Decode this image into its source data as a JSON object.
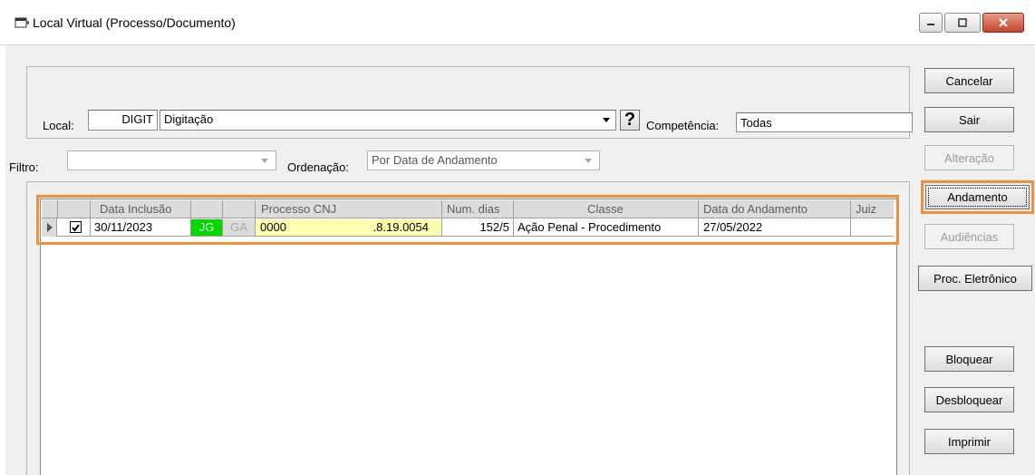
{
  "window": {
    "title": "Local Virtual (Processo/Documento)"
  },
  "form": {
    "local_label": "Local:",
    "local_code": "DIGIT",
    "local_name": "Digitação",
    "help_button": "?",
    "competencia_label": "Competência:",
    "competencia_value": "Todas",
    "filtro_label": "Filtro:",
    "filtro_value": "",
    "ordenacao_label": "Ordenação:",
    "ordenacao_value": "Por Data de Andamento"
  },
  "grid": {
    "headers": [
      "Data Inclusão",
      "Processo CNJ",
      "Num. dias",
      "Classe",
      "Data do Andamento",
      "Juiz"
    ],
    "rows": [
      {
        "checked": true,
        "data_inclusao": "30/11/2023",
        "badge1": "JG",
        "badge2": "GA",
        "processo_a": "0000",
        "processo_b": ".8.19.0054",
        "num_dias": "152/5",
        "classe": "Ação Penal - Procedimento",
        "data_andamento": "27/05/2022",
        "juiz": ""
      }
    ]
  },
  "buttons": {
    "cancelar": "Cancelar",
    "sair": "Sair",
    "alteracao": "Alteração",
    "andamento": "Andamento",
    "audiencias": "Audiências",
    "proc_eletronico": "Proc. Eletrônico",
    "bloquear": "Bloquear",
    "desbloquear": "Desbloquear",
    "imprimir": "Imprimir"
  },
  "colors": {
    "highlight": "#f0913a",
    "badge_jg": "#00d800",
    "processo_bg": "#ffffb0"
  }
}
